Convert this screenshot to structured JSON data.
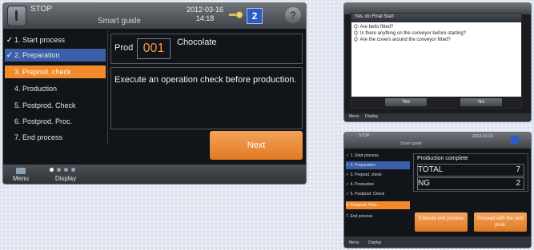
{
  "main": {
    "header": {
      "status": "STOP",
      "guide": "Smart guide",
      "date": "2012-03-16",
      "time": "14:18",
      "user_level": "2",
      "help_icon": "question-icon"
    },
    "steps": [
      {
        "mark": "✓",
        "label": "1. Start process",
        "state": "done"
      },
      {
        "mark": "✓",
        "label": "2. Preparation",
        "state": "done-current"
      },
      {
        "mark": "",
        "label": "3. Preprod. check",
        "state": "active"
      },
      {
        "mark": "",
        "label": "4. Production",
        "state": "pending"
      },
      {
        "mark": "",
        "label": "5. Postprod. Check",
        "state": "pending"
      },
      {
        "mark": "",
        "label": "6. Postprod. Proc.",
        "state": "pending"
      },
      {
        "mark": "",
        "label": "7. End process",
        "state": "pending"
      }
    ],
    "product": {
      "label": "Prod",
      "number": "001",
      "name": "Chocolate"
    },
    "message": "Execute an operation check before production.",
    "next_label": "Next",
    "bottom": {
      "menu_label": "Menu",
      "display_label": "Display"
    }
  },
  "dialog_screen": {
    "title": "Yes, do Final Start",
    "questions": [
      "Q: Are belts fitted?",
      "Q: Is there anything on the conveyor before starting?",
      "Q: Are the covers around the conveyor fitted?"
    ],
    "yes_label": "Yes",
    "no_label": "No",
    "menu_label": "Menu",
    "display_label": "Display"
  },
  "result_screen": {
    "header": {
      "status": "STOP",
      "guide": "Smart guide",
      "date": "2012-03-16"
    },
    "steps": [
      {
        "label": "✓ 1. Start process",
        "state": "done"
      },
      {
        "label": "✓ 2. Preparation",
        "state": "done-current"
      },
      {
        "label": "✓ 3. Preprod. check",
        "state": "done"
      },
      {
        "label": "✓ 4. Production",
        "state": "done"
      },
      {
        "label": "✓ 5. Postprod. Check",
        "state": "done"
      },
      {
        "label": "6. Postprod. Proc.",
        "state": "active"
      },
      {
        "label": "7. End process",
        "state": "pending"
      }
    ],
    "production_complete": "Production complete",
    "total_label": "TOTAL",
    "total_value": "7",
    "ng_label": "NG",
    "ng_value": "2",
    "execute_label": "Execute end process",
    "proceed_label": "Proceed with the next prod.",
    "menu_label": "Menu",
    "display_label": "Display"
  },
  "colors": {
    "accent_orange": "#f08a2a",
    "selected_blue": "#3a5fa8",
    "screen_bg": "#111418"
  }
}
